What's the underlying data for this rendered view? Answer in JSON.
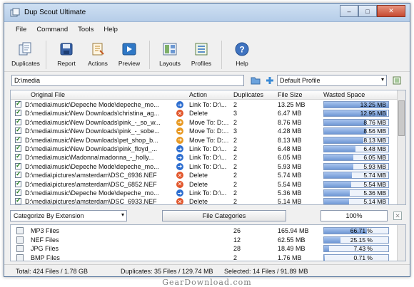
{
  "window": {
    "title": "Dup Scout Ultimate"
  },
  "menu": [
    "File",
    "Command",
    "Tools",
    "Help"
  ],
  "toolbar": [
    {
      "label": "Duplicates",
      "icon": "duplicates-icon"
    },
    {
      "label": "Report",
      "icon": "report-icon"
    },
    {
      "label": "Actions",
      "icon": "actions-icon"
    },
    {
      "label": "Preview",
      "icon": "preview-icon"
    },
    {
      "label": "Layouts",
      "icon": "layouts-icon"
    },
    {
      "label": "Profiles",
      "icon": "profiles-icon"
    },
    {
      "label": "Help",
      "icon": "help-icon"
    }
  ],
  "path": {
    "value": "D:\\media"
  },
  "profile": {
    "selected": "Default Profile"
  },
  "grid": {
    "headers": {
      "file": "Original File",
      "action": "Action",
      "duplicates": "Duplicates",
      "size": "File Size",
      "wasted": "Wasted Space"
    },
    "rows": [
      {
        "file": "D:\\media\\music\\Depeche Mode\\depeche_mo...",
        "action": "Link To: D:\\...",
        "type": "link",
        "dups": "2",
        "size": "13.25 MB",
        "wasted": "13.25 MB",
        "pct": 1.0
      },
      {
        "file": "D:\\media\\music\\New Downloads\\christina_ag...",
        "action": "Delete",
        "type": "delete",
        "dups": "3",
        "size": "6.47 MB",
        "wasted": "12.95 MB",
        "pct": 0.98
      },
      {
        "file": "D:\\media\\music\\New Downloads\\pink_-_so_w...",
        "action": "Move To: D:...",
        "type": "move",
        "dups": "2",
        "size": "8.76 MB",
        "wasted": "8.76 MB",
        "pct": 0.66
      },
      {
        "file": "D:\\media\\music\\New Downloads\\pink_-_sobe...",
        "action": "Move To: D:...",
        "type": "move",
        "dups": "3",
        "size": "4.28 MB",
        "wasted": "8.56 MB",
        "pct": 0.65
      },
      {
        "file": "D:\\media\\music\\New Downloads\\pet_shop_b...",
        "action": "Move To: D:...",
        "type": "move",
        "dups": "2",
        "size": "8.13 MB",
        "wasted": "8.13 MB",
        "pct": 0.61
      },
      {
        "file": "D:\\media\\music\\New Downloads\\pink_floyd_...",
        "action": "Link To: D:\\...",
        "type": "link",
        "dups": "2",
        "size": "6.48 MB",
        "wasted": "6.48 MB",
        "pct": 0.49
      },
      {
        "file": "D:\\media\\music\\Madonna\\madonna_-_holly...",
        "action": "Link To: D:\\...",
        "type": "link",
        "dups": "2",
        "size": "6.05 MB",
        "wasted": "6.05 MB",
        "pct": 0.46
      },
      {
        "file": "D:\\media\\music\\Depeche Mode\\depeche_mo...",
        "action": "Link To: D:\\...",
        "type": "link",
        "dups": "2",
        "size": "5.93 MB",
        "wasted": "5.93 MB",
        "pct": 0.45
      },
      {
        "file": "D:\\media\\pictures\\amsterdam\\DSC_6936.NEF",
        "action": "Delete",
        "type": "delete",
        "dups": "2",
        "size": "5.74 MB",
        "wasted": "5.74 MB",
        "pct": 0.43
      },
      {
        "file": "D:\\media\\pictures\\amsterdam\\DSC_6852.NEF",
        "action": "Delete",
        "type": "delete",
        "dups": "2",
        "size": "5.54 MB",
        "wasted": "5.54 MB",
        "pct": 0.42
      },
      {
        "file": "D:\\media\\music\\Depeche Mode\\depeche_mo...",
        "action": "Link To: D:\\...",
        "type": "link",
        "dups": "2",
        "size": "5.36 MB",
        "wasted": "5.36 MB",
        "pct": 0.4
      },
      {
        "file": "D:\\media\\pictures\\amsterdam\\DSC_6933.NEF",
        "action": "Delete",
        "type": "delete",
        "dups": "2",
        "size": "5.14 MB",
        "wasted": "5.14 MB",
        "pct": 0.39
      }
    ]
  },
  "categorize": {
    "selected": "Categorize By Extension",
    "button": "File Categories",
    "percent": "100%",
    "close": "✕"
  },
  "categories": [
    {
      "name": "MP3 Files",
      "count": "26",
      "size": "165.94 MB",
      "pct_label": "66.71 %",
      "pct": 0.6671
    },
    {
      "name": "NEF Files",
      "count": "12",
      "size": "62.55 MB",
      "pct_label": "25.15 %",
      "pct": 0.2515
    },
    {
      "name": "JPG Files",
      "count": "28",
      "size": "18.49 MB",
      "pct_label": "7.43 %",
      "pct": 0.0743
    },
    {
      "name": "BMP Files",
      "count": "2",
      "size": "1.76 MB",
      "pct_label": "0.71 %",
      "pct": 0.0071
    }
  ],
  "status": {
    "total": "Total: 424 Files / 1.78 GB",
    "duplicates": "Duplicates: 35 Files / 129.74 MB",
    "selected": "Selected: 14 Files / 91.89 MB"
  },
  "watermark": "GearDownload.com",
  "colors": {
    "link": "#2f6fd0",
    "delete": "#e2562b",
    "move": "#e89a24"
  }
}
